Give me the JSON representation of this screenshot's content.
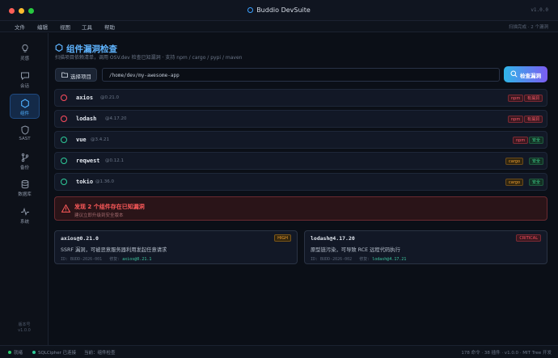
{
  "window": {
    "title": "Buddio DevSuite",
    "version": "v1.0.0"
  },
  "menu": {
    "items": [
      "文件",
      "编辑",
      "视图",
      "工具",
      "帮助"
    ],
    "right_text": "扫描完成 · 2 个漏洞"
  },
  "sidebar": {
    "items": [
      {
        "label": "灵感",
        "icon": "bulb-icon"
      },
      {
        "label": "会话",
        "icon": "chat-icon"
      },
      {
        "label": "组件",
        "icon": "hexagon-icon",
        "active": true
      },
      {
        "label": "SAST",
        "icon": "shield-icon"
      },
      {
        "label": "备份",
        "icon": "branch-icon"
      },
      {
        "label": "数据库",
        "icon": "database-icon"
      },
      {
        "label": "系统",
        "icon": "pulse-icon"
      }
    ],
    "footer_label": "版本号",
    "footer_version": "v1.0.0"
  },
  "page": {
    "title": "组件漏洞检查",
    "subtitle": "扫描项目依赖清单，调用 OSV.dev 检查已知漏洞 · 支持 npm / cargo / pypi / maven",
    "select_button": "选择项目",
    "path_value": "/home/dev/my-awesome-app",
    "scan_button": "检查漏洞"
  },
  "packages": [
    {
      "name": "axios",
      "version": "@0.21.0",
      "ecosystem": "npm",
      "status": "有漏洞",
      "vulnerable": true
    },
    {
      "name": "lodash",
      "version": "@4.17.20",
      "ecosystem": "npm",
      "status": "有漏洞",
      "vulnerable": true
    },
    {
      "name": "vue",
      "version": "@3.4.21",
      "ecosystem": "npm",
      "status": "安全",
      "vulnerable": false
    },
    {
      "name": "reqwest",
      "version": "@0.12.1",
      "ecosystem": "cargo",
      "status": "安全",
      "vulnerable": false
    },
    {
      "name": "tokio",
      "version": "@1.36.0",
      "ecosystem": "cargo",
      "status": "安全",
      "vulnerable": false
    }
  ],
  "alert": {
    "title": "发现 2 个组件存在已知漏洞",
    "subtitle": "建议立即升级到安全版本"
  },
  "vulns": [
    {
      "package": "axios@0.21.0",
      "severity": "HIGH",
      "description": "SSRF 漏洞，可被恶意服务器利用发起任意请求",
      "id_label": "ID:",
      "id": "BUDD-2026-001",
      "fix_label": "修复:",
      "fix": "axios@0.21.1"
    },
    {
      "package": "lodash@4.17.20",
      "severity": "CRITICAL",
      "description": "原型链污染，可导致 RCE 远程代码执行",
      "id_label": "ID:",
      "id": "BUDD-2026-002",
      "fix_label": "修复:",
      "fix": "lodash@4.17.21"
    }
  ],
  "status": {
    "ready": "就绪",
    "db": "SQLCipher 已连接",
    "current": "当前：组件检查",
    "right": "178 命令 · 38 插件 · v1.0.0 · MIT Tree 开发"
  },
  "colors": {
    "accent": "#4fb0ff",
    "danger": "#ff4d5e",
    "safe": "#2ecc71",
    "high": "#f0a030",
    "critical": "#ff4d5e"
  }
}
